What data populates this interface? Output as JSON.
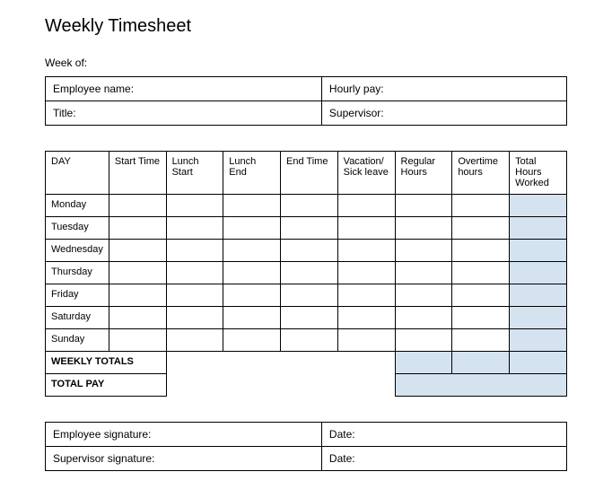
{
  "title": "Weekly Timesheet",
  "week_of_label": "Week of:",
  "info": {
    "employee_name_label": "Employee name:",
    "hourly_pay_label": "Hourly pay:",
    "title_label": "Title:",
    "supervisor_label": "Supervisor:"
  },
  "timesheet": {
    "headers": {
      "day": "DAY",
      "start_time": "Start Time",
      "lunch_start": "Lunch Start",
      "lunch_end": "Lunch End",
      "end_time": "End Time",
      "vacation_sick": "Vacation/ Sick leave",
      "regular_hours": "Regular Hours",
      "overtime_hours": "Overtime hours",
      "total_hours_worked": "Total Hours Worked"
    },
    "days": [
      "Monday",
      "Tuesday",
      "Wednesday",
      "Thursday",
      "Friday",
      "Saturday",
      "Sunday"
    ],
    "weekly_totals_label": "WEEKLY TOTALS",
    "total_pay_label": "TOTAL PAY"
  },
  "signatures": {
    "employee_signature_label": "Employee signature:",
    "supervisor_signature_label": "Supervisor signature:",
    "date_label": "Date:"
  }
}
